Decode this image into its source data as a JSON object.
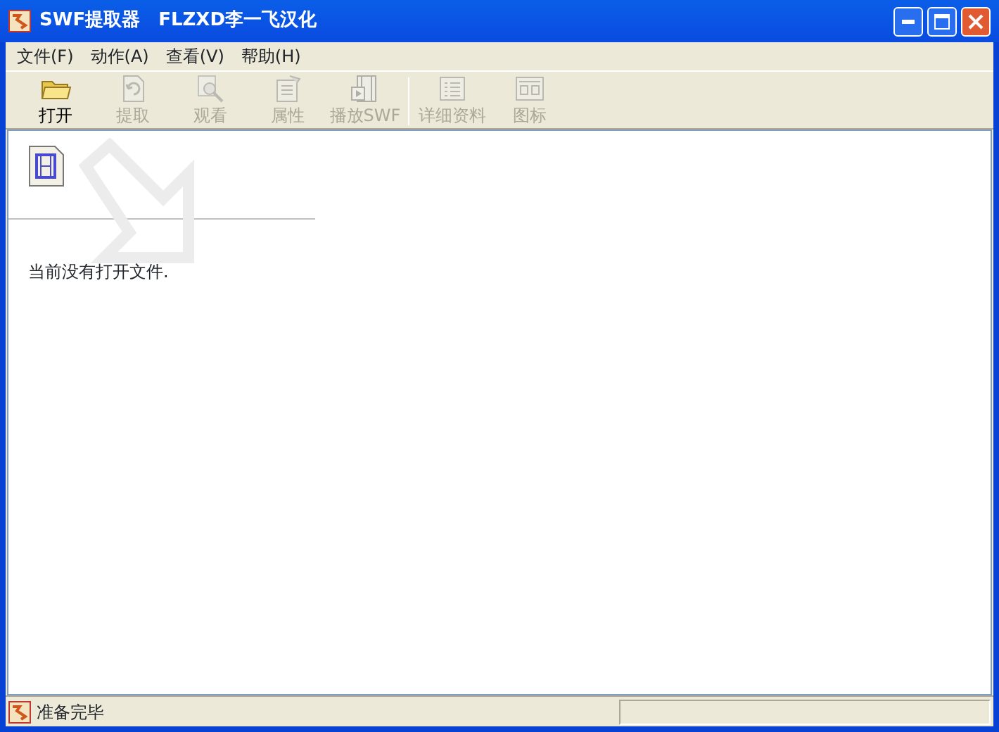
{
  "window": {
    "title": "SWF提取器　FLZXD李一飞汉化"
  },
  "menu": [
    {
      "label": "文件(F)"
    },
    {
      "label": "动作(A)"
    },
    {
      "label": "查看(V)"
    },
    {
      "label": "帮助(H)"
    }
  ],
  "toolbar": [
    {
      "kind": "open",
      "label": "打开",
      "disabled": false
    },
    {
      "kind": "extract",
      "label": "提取",
      "disabled": true
    },
    {
      "kind": "view",
      "label": "观看",
      "disabled": true
    },
    {
      "kind": "properties",
      "label": "属性",
      "disabled": true
    },
    {
      "kind": "play",
      "label": "播放SWF",
      "disabled": true
    },
    {
      "kind": "separator"
    },
    {
      "kind": "details",
      "label": "详细资料",
      "disabled": true
    },
    {
      "kind": "icons",
      "label": "图标",
      "disabled": true
    }
  ],
  "content": {
    "message": "当前没有打开文件."
  },
  "status_bar": {
    "text": "准备完毕"
  }
}
